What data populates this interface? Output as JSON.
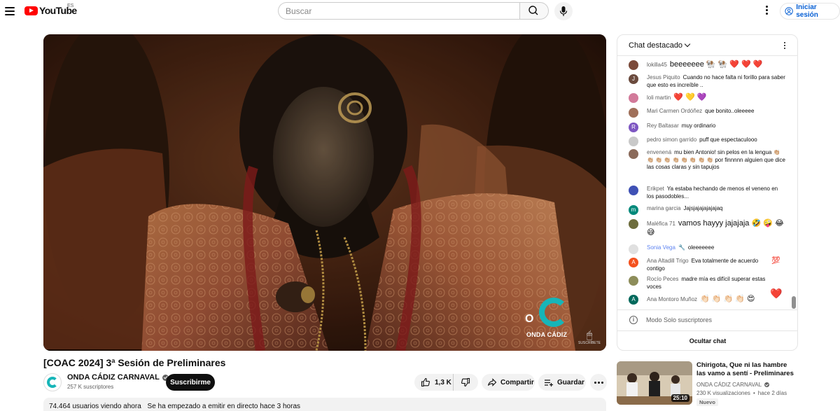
{
  "header": {
    "logo_text": "YouTube",
    "country_code": "ES",
    "search_placeholder": "Buscar",
    "signin_label": "Iniciar sesión"
  },
  "video": {
    "title": "[COAC 2024] 3ª Sesión de Preliminares",
    "watermark_text": "ONDA CÁDIZ",
    "watermark_letter": "O",
    "subscribe_watermark": "SUSCRÍBETE"
  },
  "owner": {
    "channel_name": "ONDA CÁDIZ CARNAVAL",
    "subscribers": "257 K suscriptores",
    "subscribe_label": "Suscribirme"
  },
  "actions": {
    "likes": "1,3 K",
    "share_label": "Compartir",
    "save_label": "Guardar"
  },
  "description": {
    "viewers": "74.464 usuarios viendo ahora",
    "started": "Se ha empezado a emitir en directo hace 3 horas"
  },
  "chat": {
    "header": "Chat destacado",
    "messages": [
      {
        "author": "lokilla45",
        "text": "beeeeeee 🐏 🐏 ❤️ ❤️ ❤️",
        "avatar_color": "#7b4a3a",
        "initial": ""
      },
      {
        "author": "Jesus Piquito",
        "text": "Cuando no hace falta ni forillo para saber que esto es increíble ..",
        "avatar_color": "#6b4b3e",
        "initial": "J"
      },
      {
        "author": "loli martin",
        "text": "❤️ 💛 💜",
        "avatar_color": "#d27a9a",
        "initial": ""
      },
      {
        "author": "Mari Carmen Ordóñez",
        "text": "que bonito..oleeeee",
        "avatar_color": "#a0705a",
        "initial": ""
      },
      {
        "author": "Rey Baltasar",
        "text": "muy ordinario",
        "avatar_color": "#7e57c2",
        "initial": "R"
      },
      {
        "author": "pedro simon garrido",
        "text": "puff que espectaculooo",
        "avatar_color": "#c9c9c9",
        "initial": ""
      },
      {
        "author": "envenená",
        "text": "mu bien Antonio! sin pelos en la lengua 👏🏼 👏🏼 👏🏼 👏🏼 👏🏼 👏🏼 👏🏼 👏🏼 👏🏼 por finnnnn alguien que dice las cosas claras y sin tapujos",
        "avatar_color": "#8a6a5a",
        "initial": ""
      },
      {
        "author": "Erikpet",
        "text": "Ya estaba hechando de menos el veneno en los pasodobles...",
        "avatar_color": "#3f51b5",
        "initial": ""
      },
      {
        "author": "marina garcia",
        "text": "Jajsjajajajajajaq",
        "avatar_color": "#00897b",
        "initial": "m"
      },
      {
        "author": "Maléfica 71",
        "text": "vamos hayyy jajajaja 🤣 🤪 😂 😅",
        "avatar_color": "#6d6d3d",
        "initial": ""
      },
      {
        "author": "Sonia Vega",
        "text": "oleeeeeee",
        "avatar_color": "#e0e0e0",
        "initial": ""
      },
      {
        "author": "Ana Altadill Trigo",
        "text": "Eva totalmente de acuerdo contigo",
        "avatar_color": "#f4511e",
        "initial": "A"
      },
      {
        "author": "Rocío Peces",
        "text": "madre mía es difícil superar estas voces",
        "avatar_color": "#8d8d5a",
        "initial": ""
      },
      {
        "author": "Ana Montoro Muñoz",
        "text": "👏🏻 👏🏻 👏🏻 👏🏻 😍",
        "avatar_color": "#00695c",
        "initial": "A"
      }
    ],
    "badge_100": "💯",
    "floating_heart": "❤️",
    "mode_text": "Modo Solo suscriptores",
    "hide_label": "Ocultar chat"
  },
  "recommendation": {
    "title": "Chirigota, Que ni las hambre las vamo a sentí - Preliminares",
    "channel": "ONDA CÁDIZ CARNAVAL",
    "views": "230 K visualizaciones",
    "age": "hace 2 días",
    "badge": "Nuevo",
    "duration": "25:10"
  }
}
